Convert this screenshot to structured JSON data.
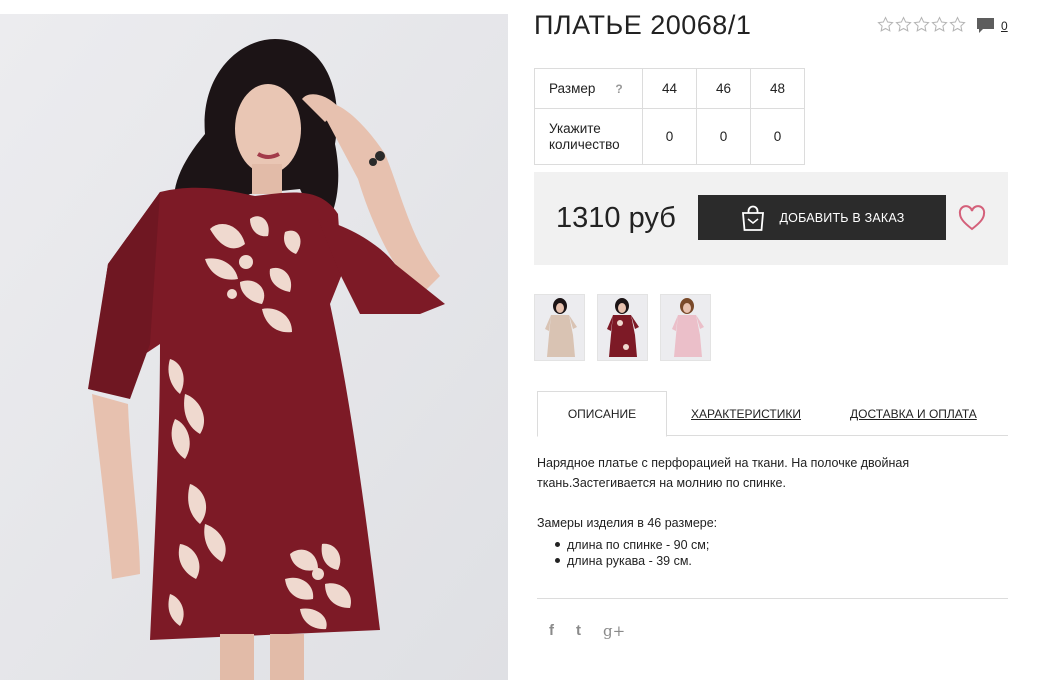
{
  "product": {
    "title": "ПЛАТЬЕ 20068/1",
    "rating": {
      "value": 0,
      "max": 5
    },
    "comments_count": "0",
    "colors": {
      "dress": "#7d1a26",
      "accent_heart": "#d4607a",
      "button_bg": "#2b2b2b",
      "buybar_bg": "#f1f1f1"
    }
  },
  "sizes": {
    "size_label": "Размер",
    "help_label": "?",
    "qty_label": "Укажите количество",
    "columns": [
      "44",
      "46",
      "48"
    ],
    "quantities": [
      "0",
      "0",
      "0"
    ]
  },
  "buy": {
    "price": "1310 руб",
    "add_label": "ДОБАВИТЬ В ЗАКАЗ",
    "add_icon": "shopping-bag-icon",
    "wishlist_icon": "heart-icon"
  },
  "thumbnails": [
    {
      "name": "thumb-beige-dress",
      "color": "#d9c3b3"
    },
    {
      "name": "thumb-burgundy-dress",
      "color": "#7d1a26"
    },
    {
      "name": "thumb-pink-dress",
      "color": "#ebbfc9"
    }
  ],
  "tabs": [
    {
      "label": "ОПИСАНИЕ",
      "active": true
    },
    {
      "label": "ХАРАКТЕРИСТИКИ",
      "active": false
    },
    {
      "label": "ДОСТАВКА И ОПЛАТА",
      "active": false
    }
  ],
  "description": {
    "text": "Нарядное платье с перфорацией на ткани. На полочке двойная ткань.Застегивается на молнию по спинке.",
    "measurements_title": "Замеры изделия в 46 размере:",
    "measurements": [
      "длина по спинке - 90 см;",
      "длина рукава - 39 см."
    ]
  },
  "social": {
    "facebook": "f",
    "twitter": "t",
    "googleplus": "g+"
  }
}
